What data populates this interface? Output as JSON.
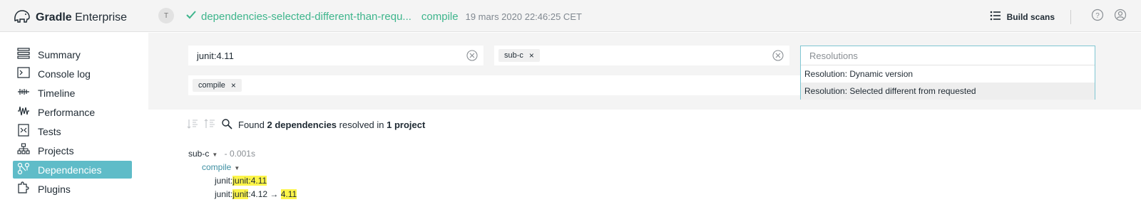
{
  "header": {
    "logo_bold": "Gradle",
    "logo_light": " Enterprise",
    "avatar_letter": "T",
    "build_name": "dependencies-selected-different-than-requ...",
    "build_task": "compile",
    "build_date": "19 mars 2020 22:46:25 CET",
    "build_scans_label": "Build scans",
    "icons": [
      "elephant-logo",
      "check-icon",
      "list-icon",
      "help-icon",
      "user-icon"
    ]
  },
  "sidebar": {
    "items": [
      {
        "label": "Summary",
        "icon": "summary-icon"
      },
      {
        "label": "Console log",
        "icon": "console-icon"
      },
      {
        "label": "Timeline",
        "icon": "timeline-icon"
      },
      {
        "label": "Performance",
        "icon": "performance-icon"
      },
      {
        "label": "Tests",
        "icon": "tests-icon"
      },
      {
        "label": "Projects",
        "icon": "projects-icon"
      },
      {
        "label": "Dependencies",
        "icon": "dependencies-icon",
        "active": true
      },
      {
        "label": "Plugins",
        "icon": "plugins-icon"
      }
    ]
  },
  "filters": {
    "search_value": "junit:4.11",
    "project_chip": "sub-c",
    "config_chip": "compile",
    "chip_remove": "×"
  },
  "dropdown": {
    "placeholder": "Resolutions",
    "options": [
      {
        "label": "Resolution: Dynamic version"
      },
      {
        "label": "Resolution: Selected different from requested",
        "selected": true
      }
    ]
  },
  "results": {
    "found_prefix": "Found ",
    "dep_count": "2 dependencies",
    "mid": " resolved in ",
    "project_count": "1 project",
    "tree": {
      "project": "sub-c",
      "project_time": "- 0.001s",
      "configuration": "compile",
      "deps": [
        {
          "group": "junit:",
          "name": "junit",
          "version_sep": ":",
          "version": "4.11"
        },
        {
          "group": "junit:",
          "name": "junit",
          "version_sep": ":",
          "requested": "4.12",
          "arrow": "→",
          "version": "4.11"
        }
      ]
    }
  },
  "colors": {
    "accent_green": "#3eb58c",
    "active_nav": "#5fbcc8",
    "highlight": "#fdf54a"
  }
}
